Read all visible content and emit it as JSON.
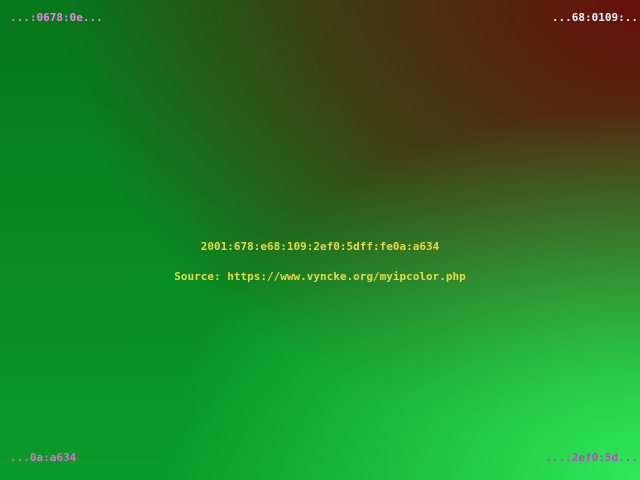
{
  "colors": {
    "top_left_bg": "#06781a",
    "top_right_bg": "#680f0c",
    "bottom_left_bg": "#0a9b2a",
    "bottom_right_bg": "#2ee856",
    "text_yellow": "#e8d84a",
    "text_top_left": "#ee82ee",
    "text_top_right": "#e0f8ff",
    "text_bottom_left": "#e070d0",
    "text_bottom_right": "#c040d0"
  },
  "corners": {
    "top_left": "...:0678:0e...",
    "top_right": "...68:0109:..",
    "bottom_left": "...0a:a634",
    "bottom_right": "...:2ef0:5d..."
  },
  "center": {
    "address": "2001:678:e68:109:2ef0:5dff:fe0a:a634",
    "source": "Source: https://www.vyncke.org/myipcolor.php"
  }
}
